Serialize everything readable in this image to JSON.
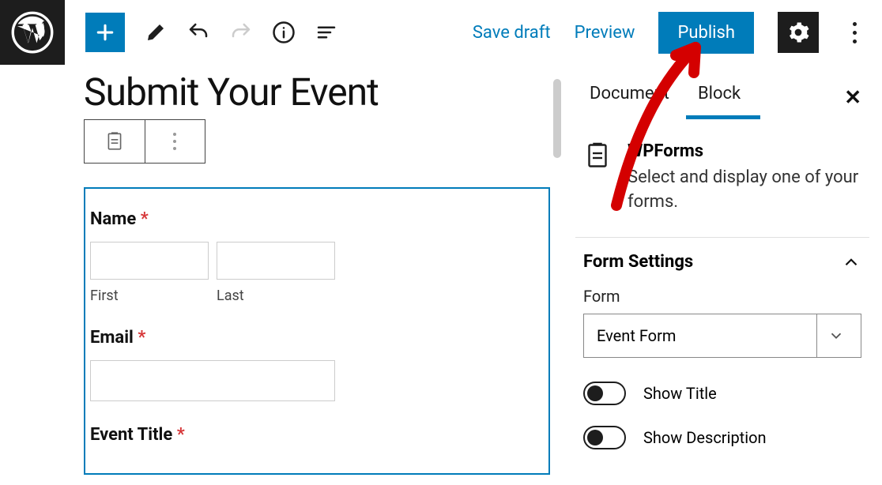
{
  "toolbar": {
    "save_draft": "Save draft",
    "preview": "Preview",
    "publish": "Publish"
  },
  "editor": {
    "post_title": "Submit Your Event",
    "form": {
      "fields": {
        "name": {
          "label": "Name",
          "first": "First",
          "last": "Last"
        },
        "email": {
          "label": "Email"
        },
        "event_title": {
          "label": "Event Title"
        }
      },
      "required_marker": "*"
    }
  },
  "sidebar": {
    "tabs": {
      "document": "Document",
      "block": "Block"
    },
    "wpforms": {
      "title": "WPForms",
      "desc": "Select and display one of your forms."
    },
    "form_settings": {
      "heading": "Form Settings",
      "form_label": "Form",
      "selected_form": "Event Form",
      "show_title": "Show Title",
      "show_description": "Show Description"
    }
  }
}
